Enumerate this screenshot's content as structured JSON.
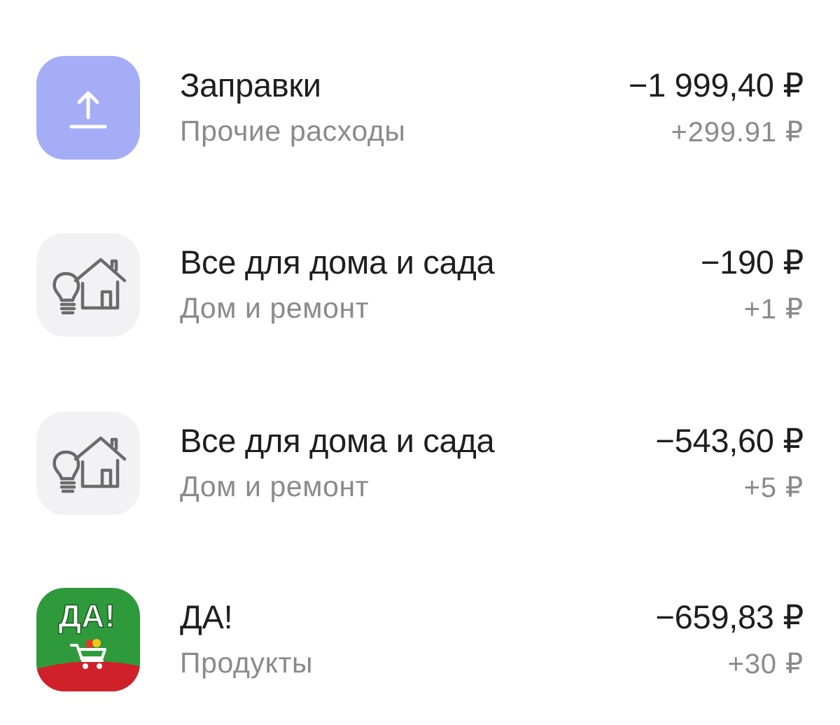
{
  "transactions": [
    {
      "title": "Заправки",
      "category": "Прочие расходы",
      "amount": "−1 999,40 ₽",
      "cashback": "+299.91 ₽",
      "icon": "upload-arrow-icon",
      "icon_bg": "#a5adf7"
    },
    {
      "title": "Все для дома и сада",
      "category": "Дом и ремонт",
      "amount": "−190 ₽",
      "cashback": "+1 ₽",
      "icon": "house-lightbulb-icon",
      "icon_bg": "#f2f2f4"
    },
    {
      "title": "Все для дома и сада",
      "category": "Дом и ремонт",
      "amount": "−543,60 ₽",
      "cashback": "+5 ₽",
      "icon": "house-lightbulb-icon",
      "icon_bg": "#f2f2f4"
    },
    {
      "title": "ДА!",
      "category": "Продукты",
      "amount": "−659,83 ₽",
      "cashback": "+30 ₽",
      "icon": "da-store-logo-icon",
      "icon_bg": "#2f9a3c",
      "logo_text": "ДА!"
    }
  ],
  "colors": {
    "primary_text": "#1e1e1e",
    "secondary_text": "#8a8a8e",
    "da_green": "#2f9a3c",
    "da_red": "#d0202a"
  }
}
